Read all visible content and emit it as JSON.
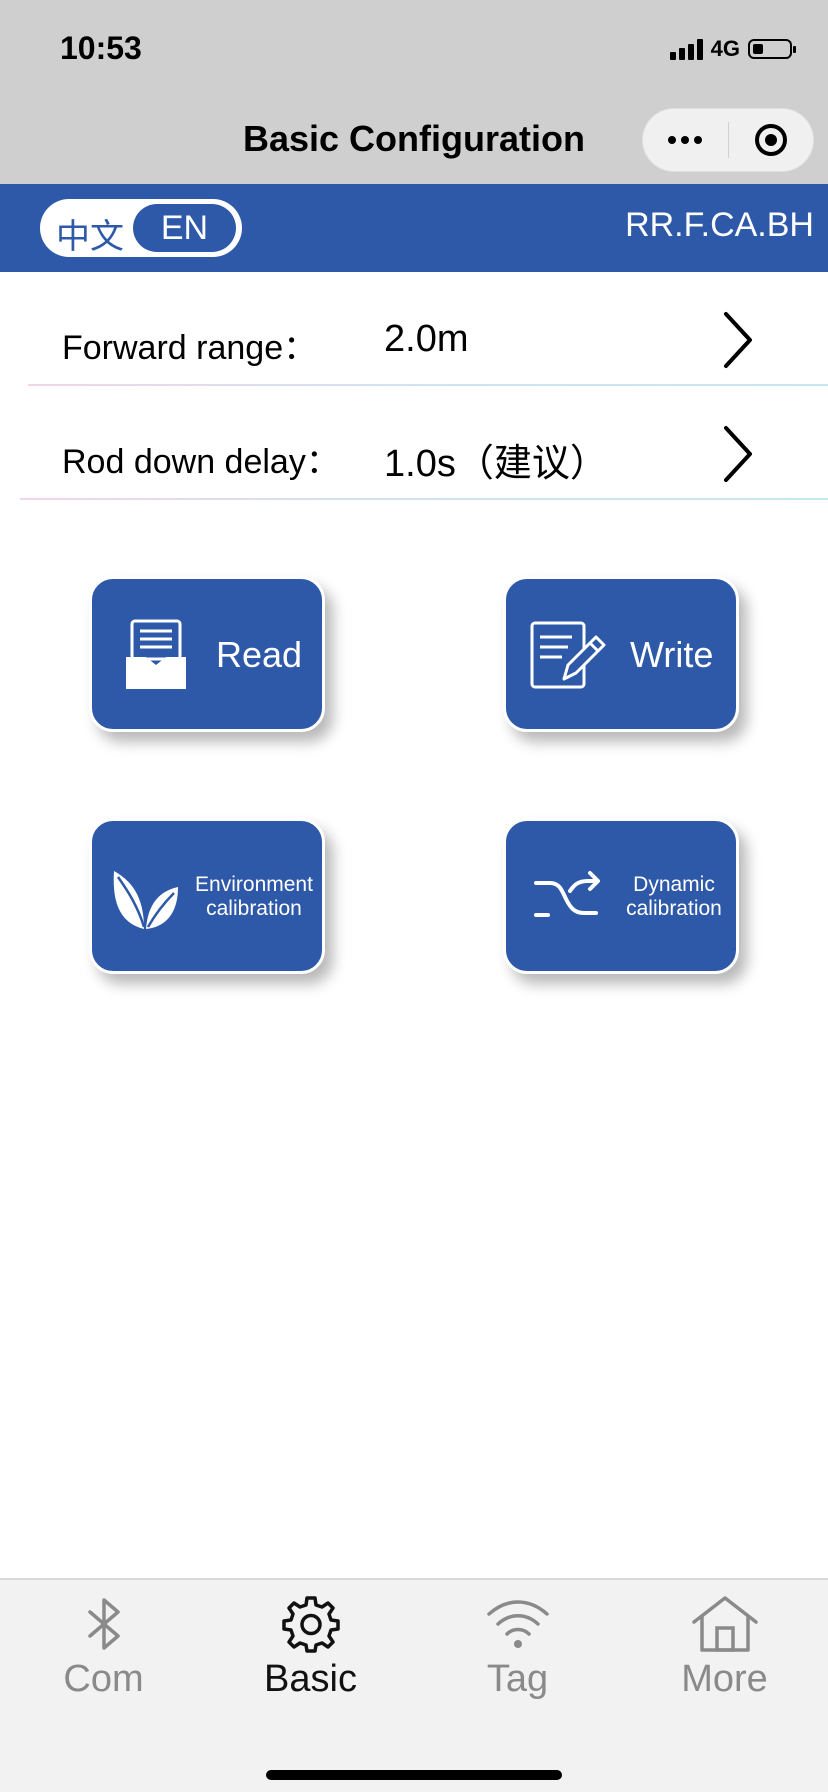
{
  "status_bar": {
    "time": "10:53",
    "network": "4G"
  },
  "nav": {
    "title": "Basic Configuration"
  },
  "lang_toggle": {
    "zh": "中文",
    "en": "EN",
    "selected": "EN"
  },
  "model_code": "RR.F.CA.BH",
  "settings": [
    {
      "label": "Forward range：",
      "value": "2.0m"
    },
    {
      "label": "Rod down delay：",
      "value": "1.0s（建议）"
    }
  ],
  "actions": {
    "read": "Read",
    "write": "Write",
    "env_line1": "Environment",
    "env_line2": "calibration",
    "dyn_line1": "Dynamic",
    "dyn_line2": "calibration"
  },
  "tabs": [
    {
      "label": "Com",
      "icon": "bluetooth-icon",
      "active": false
    },
    {
      "label": "Basic",
      "icon": "gear-icon",
      "active": true
    },
    {
      "label": "Tag",
      "icon": "wifi-icon",
      "active": false
    },
    {
      "label": "More",
      "icon": "home-icon",
      "active": false
    }
  ],
  "colors": {
    "brand": "#2e59a8",
    "chrome": "#cfcfcf",
    "tab_inactive": "#8a8a8a"
  }
}
